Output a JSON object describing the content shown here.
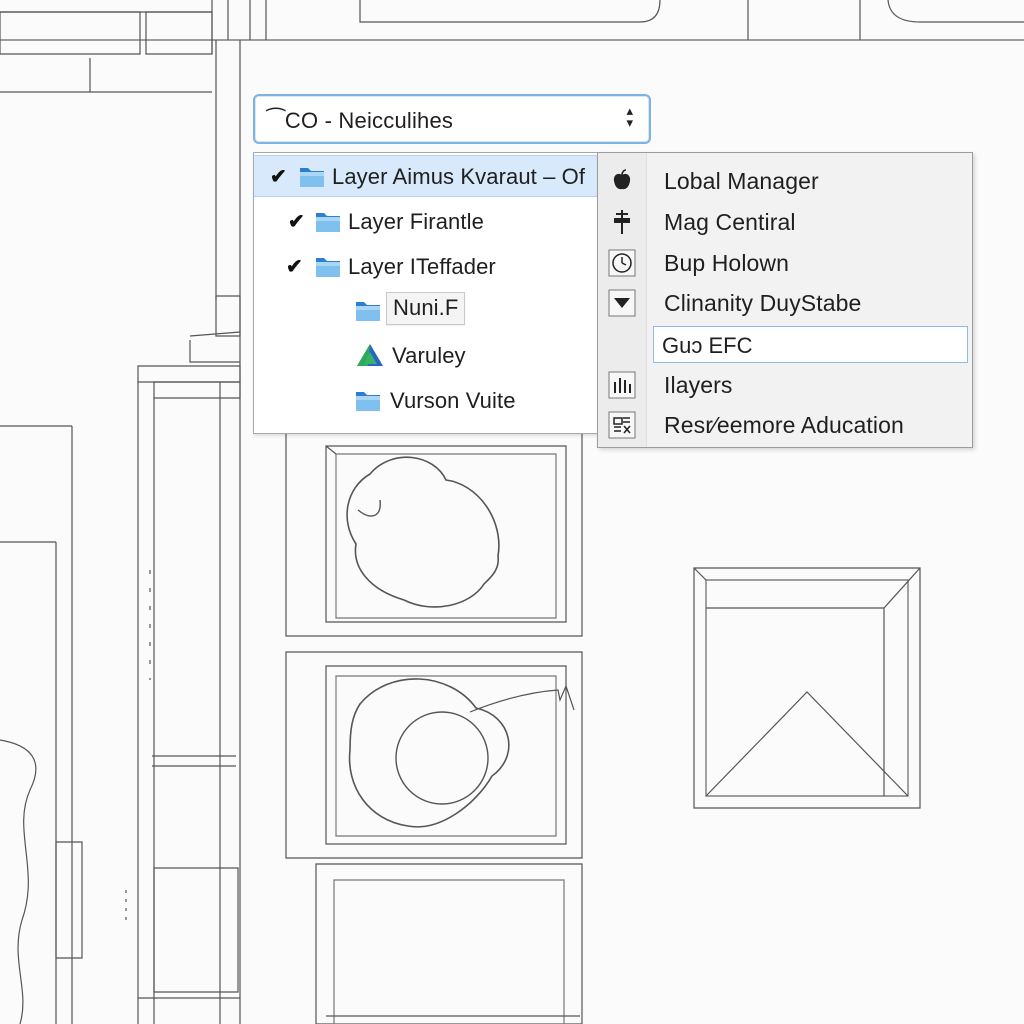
{
  "layer_selector": {
    "value": "⁀CO - Neicculihes"
  },
  "layers": [
    {
      "label": "Layer Aimus Kvaraut – Of",
      "checked": true,
      "icon": "folder-icon",
      "selected": true
    },
    {
      "label": "Layer Firantle",
      "checked": true,
      "icon": "folder-icon",
      "selected": false
    },
    {
      "label": "Layer ITeffader",
      "checked": true,
      "icon": "folder-icon",
      "selected": false
    },
    {
      "label": "Nuni.F",
      "checked": false,
      "icon": "folder-icon",
      "selected": false
    },
    {
      "label": "Varuley",
      "checked": false,
      "icon": "triangle-layer-icon",
      "selected": false
    },
    {
      "label": "Vurson Vuite",
      "checked": false,
      "icon": "folder-icon",
      "selected": false
    }
  ],
  "check_glyph": "✔",
  "context_menu": {
    "items": [
      {
        "label": "Lobal Manager",
        "icon": "apple-icon"
      },
      {
        "label": "Mag Centiral",
        "icon": "pin-icon"
      },
      {
        "label": "Bup Holown",
        "icon": "clock-icon"
      },
      {
        "label": "Clinanity DuyStabe",
        "icon": "dropdown-arrow-icon"
      },
      {
        "label": "Guɔ EFC",
        "icon": "",
        "editing": true
      },
      {
        "label": "Ilayers",
        "icon": "bar-chart-icon"
      },
      {
        "label": "Resr⁄eemore Aducation",
        "icon": "grid-icon"
      }
    ]
  },
  "colors": {
    "accent": "#7fb2e0",
    "selection": "#d7e9fb",
    "folder_light": "#7fc0ef",
    "folder_dark": "#2c7fd0",
    "triangle_green": "#2faa5a",
    "triangle_blue": "#2a64c4",
    "drawing_line": "#555555"
  }
}
